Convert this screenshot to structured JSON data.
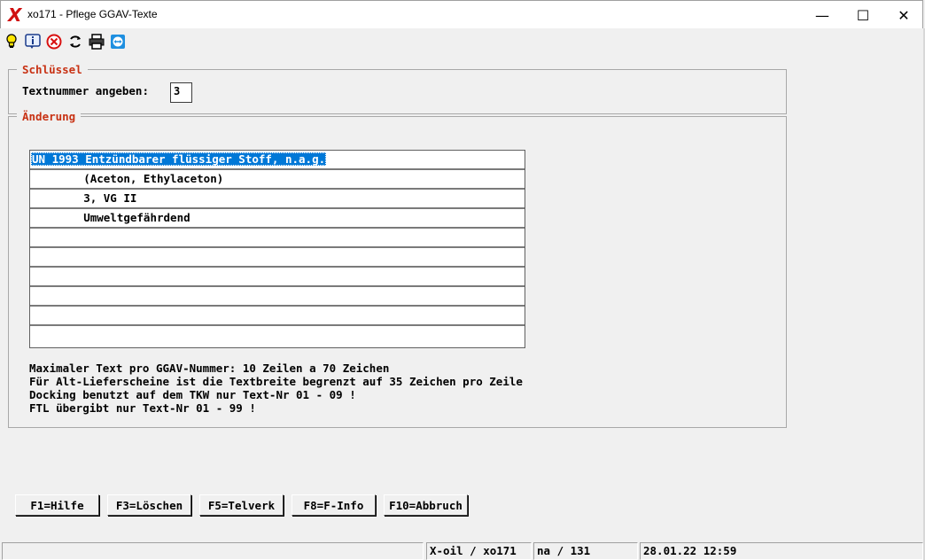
{
  "window": {
    "title": "xo171 - Pflege GGAV-Texte",
    "app_icon": "X",
    "minimize": "—",
    "maximize": "☐",
    "close": "✕"
  },
  "toolbar": {
    "icons": [
      "lightbulb-icon",
      "info-icon",
      "cancel-icon",
      "refresh-icon",
      "print-icon",
      "teamviewer-icon"
    ]
  },
  "key_group": {
    "label": "Schlüssel",
    "field_label": "Textnummer angeben:",
    "field_value": "3"
  },
  "change_group": {
    "label": "Änderung",
    "rows": [
      "UN 1993 Entzündbarer flüssiger Stoff, n.a.g.",
      "        (Aceton, Ethylaceton)",
      "        3, VG II",
      "        Umweltgefährdend",
      "",
      "",
      "",
      "",
      "",
      ""
    ],
    "info_lines": [
      "Maximaler Text pro GGAV-Nummer: 10 Zeilen a 70 Zeichen",
      "Für Alt-Lieferscheine ist die Textbreite begrenzt auf 35 Zeichen pro Zeile",
      "Docking benutzt auf dem TKW nur Text-Nr 01 - 09 !",
      "FTL übergibt nur Text-Nr 01 - 99 !"
    ]
  },
  "function_keys": [
    {
      "label": "F1=Hilfe"
    },
    {
      "label": "F3=Löschen"
    },
    {
      "label": "F5=Telverk"
    },
    {
      "label": "F8=F-Info"
    },
    {
      "label": "F10=Abbruch"
    }
  ],
  "status": {
    "app": "X-oil / xo171",
    "user": "na / 131",
    "datetime": "28.01.22 12:59"
  },
  "colors": {
    "group_label": "#c83214",
    "selection": "#0078d7",
    "app_icon": "#d01010"
  }
}
